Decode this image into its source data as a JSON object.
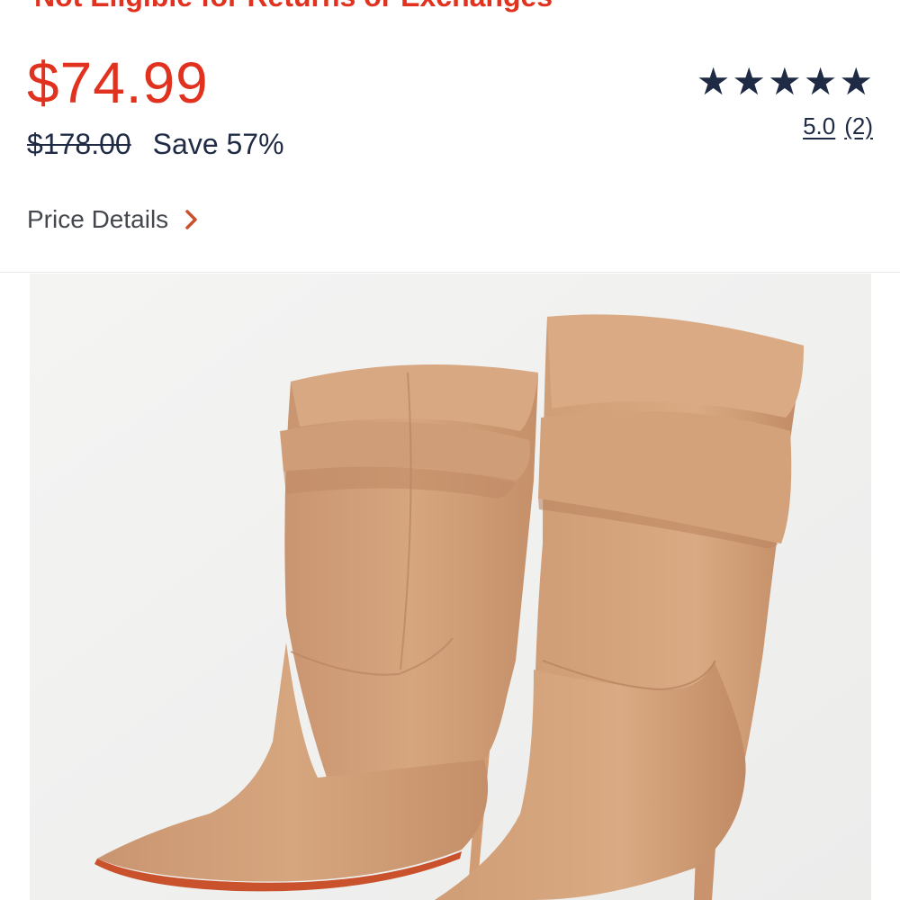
{
  "returns_note": "Not Eligible for Returns or Exchanges",
  "price": {
    "current": "$74.99",
    "original": "$178.00",
    "savings": "Save 57%"
  },
  "rating": {
    "stars": 5,
    "value": "5.0",
    "count": "(2)"
  },
  "price_details": {
    "label": "Price Details",
    "chevron_icon": "chevron-right-icon"
  },
  "product_image": {
    "description": "tan-suede-slouch-boots",
    "boot_color": "#d3a27a",
    "sole_color": "#c9522d"
  },
  "colors": {
    "accent_red": "#e0321f",
    "navy": "#1f2b44",
    "gray_text": "#44474d",
    "chevron": "#c9522d"
  }
}
